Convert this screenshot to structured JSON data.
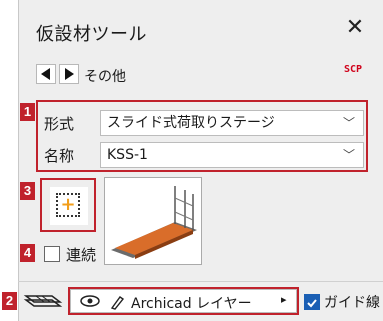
{
  "window": {
    "title": "仮設材ツール",
    "close_label": "✕"
  },
  "nav": {
    "prev_icon": "triangle-left-icon",
    "next_icon": "triangle-right-icon",
    "breadcrumb": "その他",
    "scp_badge": "SCP"
  },
  "callouts": [
    "1",
    "2",
    "3",
    "4"
  ],
  "fields": {
    "type_label": "形式",
    "type_value": "スライド式荷取りステージ",
    "name_label": "名称",
    "name_value": "KSS-1"
  },
  "controls": {
    "add_icon": "add-dotted-icon",
    "add_plus": "+",
    "continuous_label": "連続",
    "continuous_checked": false
  },
  "bottom_bar": {
    "layer_icon": "layers-icon",
    "eye_icon": "eye-icon",
    "pen_icon": "pen-icon",
    "layer_name": "Archicad レイヤー",
    "submenu_arrow": "▸",
    "guide_label": "ガイド線",
    "guide_checked": true
  },
  "colors": {
    "accent_red": "#c0222c",
    "checkbox_blue": "#1a5fb4",
    "plus_orange": "#f29e1a",
    "scp_red": "#d0021b"
  }
}
